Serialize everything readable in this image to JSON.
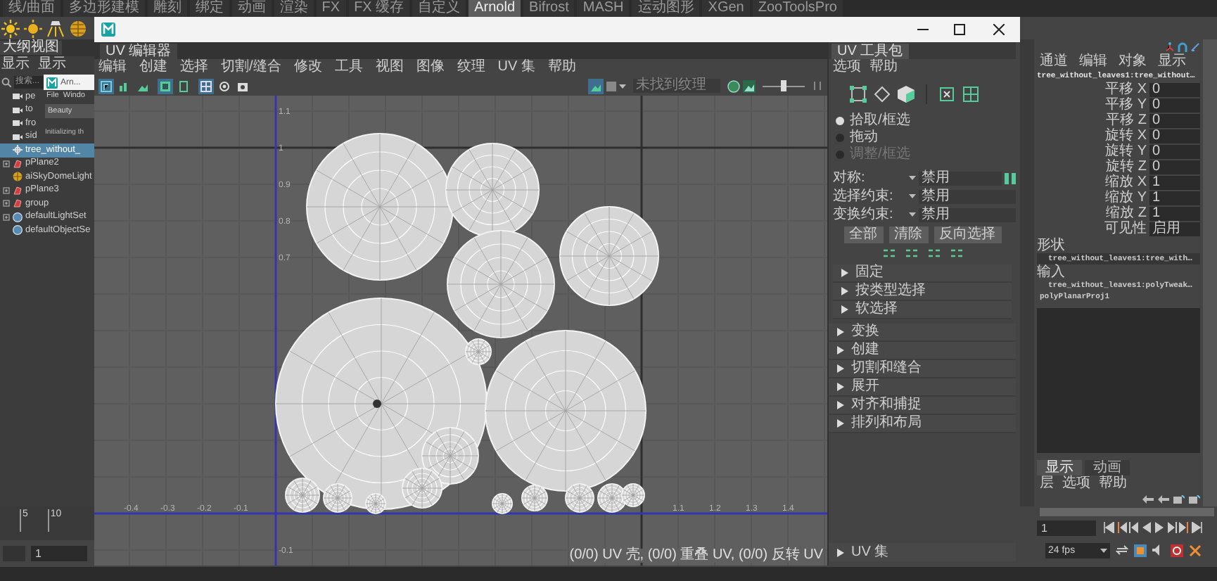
{
  "shelf_tabs": [
    {
      "label": "线/曲面",
      "selected": false
    },
    {
      "label": "多边形建模",
      "selected": false
    },
    {
      "label": "雕刻",
      "selected": false
    },
    {
      "label": "绑定",
      "selected": false
    },
    {
      "label": "动画",
      "selected": false
    },
    {
      "label": "渲染",
      "selected": false
    },
    {
      "label": "FX",
      "selected": false
    },
    {
      "label": "FX 缓存",
      "selected": false
    },
    {
      "label": "自定义",
      "selected": false
    },
    {
      "label": "Arnold",
      "selected": true
    },
    {
      "label": "Bifrost",
      "selected": false
    },
    {
      "label": "MASH",
      "selected": false
    },
    {
      "label": "运动图形",
      "selected": false
    },
    {
      "label": "XGen",
      "selected": false
    },
    {
      "label": "ZooToolsPro",
      "selected": false
    }
  ],
  "outliner": {
    "title": "大纲视图",
    "menu": [
      "显示",
      "显示"
    ],
    "search": {
      "placeholder": "搜索..."
    },
    "items": [
      {
        "label": "pe",
        "kind": "camera",
        "expandable": false,
        "selected": false
      },
      {
        "label": "to",
        "kind": "camera",
        "expandable": false,
        "selected": false
      },
      {
        "label": "fro",
        "kind": "camera",
        "expandable": false,
        "selected": false
      },
      {
        "label": "sid",
        "kind": "camera",
        "expandable": false,
        "selected": false
      },
      {
        "label": "tree_without_",
        "kind": "transform",
        "expandable": false,
        "selected": true
      },
      {
        "label": "pPlane2",
        "kind": "mesh",
        "expandable": true,
        "selected": false
      },
      {
        "label": "aiSkyDomeLight",
        "kind": "light",
        "expandable": false,
        "selected": false
      },
      {
        "label": "pPlane3",
        "kind": "mesh",
        "expandable": true,
        "selected": false
      },
      {
        "label": "group",
        "kind": "mesh",
        "expandable": true,
        "selected": false
      },
      {
        "label": "defaultLightSet",
        "kind": "set",
        "expandable": true,
        "selected": false
      },
      {
        "label": "defaultObjectSe",
        "kind": "set",
        "expandable": false,
        "selected": false
      }
    ]
  },
  "arnold_window": {
    "title": "Arn...",
    "menu": [
      "File",
      "Windo"
    ],
    "aov": "Beauty",
    "status": "Initializing th"
  },
  "uv_editor": {
    "tab": "UV 编辑器",
    "menu": [
      "编辑",
      "创建",
      "选择",
      "切割/缝合",
      "修改",
      "工具",
      "视图",
      "图像",
      "纹理",
      "UV 集",
      "帮助"
    ],
    "toolbar": [
      {
        "on": true
      },
      {
        "on": false
      },
      {
        "on": false
      },
      {
        "on": true
      },
      {
        "on": false
      },
      {
        "on": true
      },
      {
        "on": false
      },
      {
        "on": false
      }
    ],
    "texture_field": "未找到纹理",
    "exposure_slider": {
      "level": 0.5
    },
    "canvas": {
      "v_labels": [
        "1.1",
        "1",
        "0.9",
        "0.8",
        "0.7",
        "-0.1"
      ],
      "u_labels": [
        "-0.4",
        "-0.3",
        "-0.2",
        "-0.1",
        "1.1",
        "1.2",
        "1.3",
        "1.4"
      ]
    },
    "status": "(0/0) UV 壳, (0/0) 重叠 UV, (0/0) 反转 UV"
  },
  "uv_toolkit": {
    "tab": "UV 工具包",
    "menu": [
      "选项",
      "帮助"
    ],
    "modes": [
      {
        "label": "拾取/框选",
        "selected": true,
        "disabled": false
      },
      {
        "label": "拖动",
        "selected": false,
        "disabled": false
      },
      {
        "label": "调整/框选",
        "selected": false,
        "disabled": true
      }
    ],
    "constraints": [
      {
        "label": "对称:",
        "value": "禁用"
      },
      {
        "label": "选择约束:",
        "value": "禁用"
      },
      {
        "label": "变换约束:",
        "value": "禁用"
      }
    ],
    "buttons": [
      "全部",
      "清除",
      "反向选择"
    ],
    "section_groups": [
      [
        {
          "label": "固定",
          "expanded": false
        },
        {
          "label": "按类型选择",
          "expanded": false
        },
        {
          "label": "软选择",
          "expanded": false
        }
      ],
      [
        {
          "label": "变换",
          "expanded": false
        },
        {
          "label": "创建",
          "expanded": false
        },
        {
          "label": "切割和缝合",
          "expanded": false
        },
        {
          "label": "展开",
          "expanded": false
        },
        {
          "label": "对齐和捕捉",
          "expanded": false
        },
        {
          "label": "排列和布局",
          "expanded": false
        }
      ]
    ],
    "uv_sets": {
      "label": "UV 集",
      "expanded": false
    }
  },
  "channel_box": {
    "menu": [
      "通道",
      "编辑",
      "对象",
      "显示"
    ],
    "object": "tree_without_leaves1:tree_without…",
    "attributes": [
      {
        "label": "平移 X",
        "value": "0"
      },
      {
        "label": "平移 Y",
        "value": "0"
      },
      {
        "label": "平移 Z",
        "value": "0"
      },
      {
        "label": "旋转 X",
        "value": "0"
      },
      {
        "label": "旋转 Y",
        "value": "0"
      },
      {
        "label": "旋转 Z",
        "value": "0"
      },
      {
        "label": "缩放 X",
        "value": "1"
      },
      {
        "label": "缩放 Y",
        "value": "1"
      },
      {
        "label": "缩放 Z",
        "value": "1"
      },
      {
        "label": "可见性",
        "value": "启用"
      }
    ],
    "shape_heading": "形状",
    "shapes": [
      "tree_without_leaves1:tree_with…"
    ],
    "inputs_heading": "输入",
    "inputs": [
      "tree_without_leaves1:polyTweak…",
      "polyPlanarProj1"
    ]
  },
  "layer_editor": {
    "tabs": [
      {
        "label": "显示",
        "selected": true
      },
      {
        "label": "动画",
        "selected": false
      }
    ],
    "menu": [
      "层",
      "选项",
      "帮助"
    ]
  },
  "timeline": {
    "ticks": [
      "5",
      "10"
    ],
    "start_frame": "1",
    "current_frame": "1",
    "fps": "24 fps"
  }
}
